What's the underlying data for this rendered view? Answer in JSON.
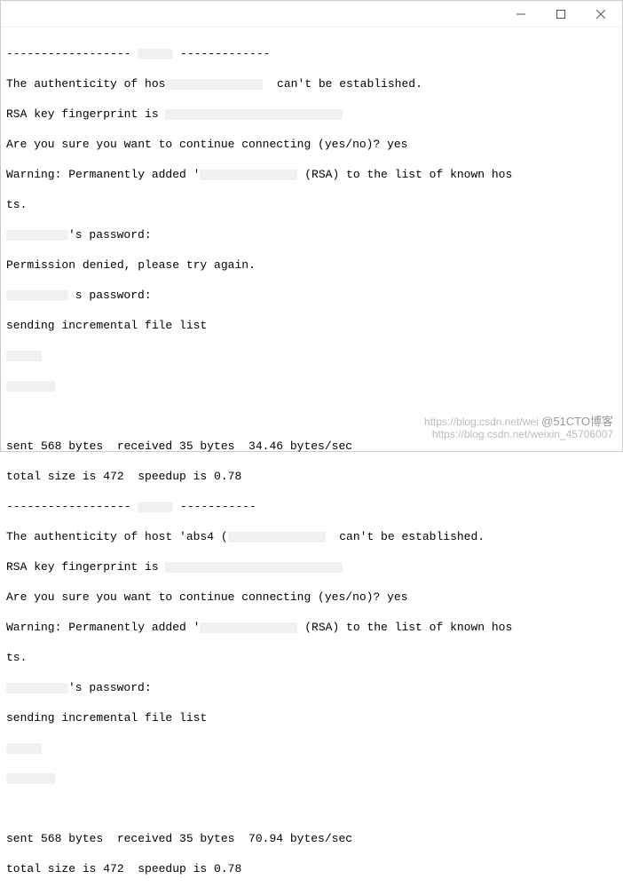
{
  "block1": {
    "dash_prefix": "------------------ ",
    "dash_suffix": " -------------",
    "auth_a": "The authenticity of hos",
    "auth_b": "  can't be established.",
    "rsa": "RSA key fingerprint is ",
    "sure": "Are you sure you want to continue connecting (yes/no)? yes",
    "warn_a": "Warning: Permanently added '",
    "warn_b": " (RSA) to the list of known hos",
    "ts": "ts.",
    "pw1": "'s password:",
    "denied": "Permission denied, please try again.",
    "pw2": " s password:",
    "sending": "sending incremental file list",
    "sent": "sent 568 bytes  received 35 bytes  34.46 bytes/sec",
    "total": "total size is 472  speedup is 0.78"
  },
  "block2": {
    "dash_prefix": "------------------ ",
    "dash_suffix": " -----------",
    "auth_a": "The authenticity of host 'abs4 (",
    "auth_b": "  can't be established.",
    "rsa": "RSA key fingerprint is ",
    "sure": "Are you sure you want to continue connecting (yes/no)? yes",
    "warn_a": "Warning: Permanently added '",
    "warn_b": " (RSA) to the list of known hos",
    "ts": "ts.",
    "pw1": "'s password:",
    "sending": "sending incremental file list",
    "sent": "sent 568 bytes  received 35 bytes  70.94 bytes/sec",
    "total": "total size is 472  speedup is 0.78"
  },
  "watermark": {
    "url": "https://blog.csdn.net/wei",
    "brand": "@51CTO博客",
    "sub": "https://blog.csdn.net/weixin_45706007"
  }
}
